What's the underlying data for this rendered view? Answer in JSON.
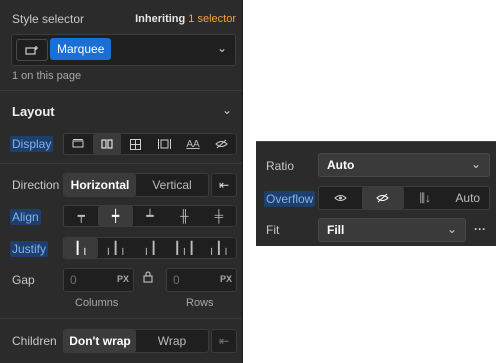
{
  "style_selector": {
    "title": "Style selector",
    "inheriting_prefix": "Inheriting",
    "inheriting_count": "1 selector",
    "chip_label": "Marquee",
    "count_text": "1 on this page"
  },
  "layout": {
    "title": "Layout",
    "display_label": "Display",
    "direction_label": "Direction",
    "direction_options": [
      "Horizontal",
      "Vertical"
    ],
    "align_label": "Align",
    "justify_label": "Justify",
    "gap_label": "Gap",
    "gap_columns_value": "0",
    "gap_rows_value": "0",
    "unit": "PX",
    "columns_label": "Columns",
    "rows_label": "Rows",
    "children_label": "Children",
    "children_options": [
      "Don't wrap",
      "Wrap"
    ],
    "display_text_option": "AA"
  },
  "right_panel": {
    "ratio_label": "Ratio",
    "ratio_value": "Auto",
    "overflow_label": "Overflow",
    "overflow_auto": "Auto",
    "fit_label": "Fit",
    "fit_value": "Fill",
    "more": "···"
  },
  "colors": {
    "accent": "#1a6fd6",
    "inheriting": "#f0a53a",
    "highlight": "#1e3f6b"
  }
}
